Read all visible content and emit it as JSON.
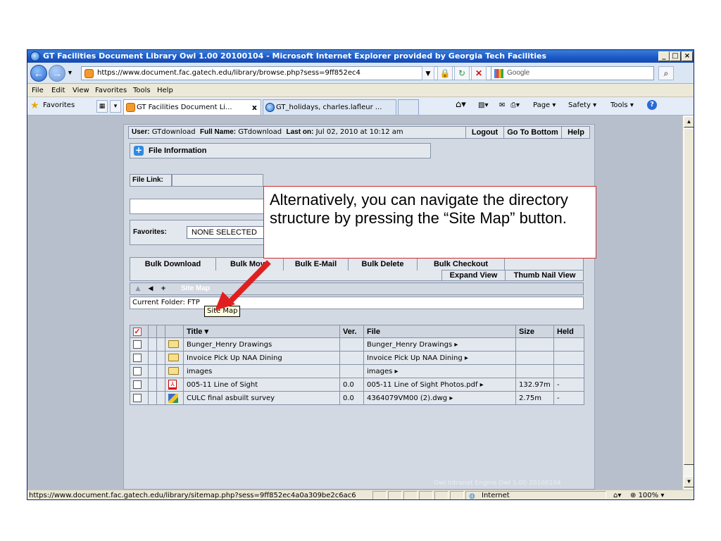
{
  "browser": {
    "title": "GT Facilities Document Library Owl 1.00 20100104 - Microsoft Internet Explorer provided by Georgia Tech Facilities",
    "address": "https://www.document.fac.gatech.edu/library/browse.php?sess=9ff852ec4",
    "search_placeholder": "Google",
    "menu": [
      "File",
      "Edit",
      "View",
      "Favorites",
      "Tools",
      "Help"
    ],
    "favorites_label": "Favorites",
    "tabs": [
      {
        "label": "GT Facilities Document Li...",
        "close": "x",
        "active": true
      },
      {
        "label": "GT_holidays, charles.lafleur ...",
        "active": false
      }
    ],
    "commands": [
      "Page",
      "Safety",
      "Tools"
    ],
    "status_url": "https://www.document.fac.gatech.edu/library/sitemap.php?sess=9ff852ec4a0a309be2c6ac6",
    "zone": "Internet",
    "zoom": "100%"
  },
  "app": {
    "user_label": "User:",
    "user": "GTdownload",
    "fullname_label": "Full Name:",
    "fullname": "GTdownload",
    "laston_label": "Last on:",
    "laston": "Jul 02, 2010 at 10:12 am",
    "buttons": {
      "logout": "Logout",
      "go_bottom": "Go To Bottom",
      "help": "Help"
    },
    "file_information": "File Information",
    "file_link": "File Link:",
    "favorites_label": "Favorites:",
    "favorites_value": "NONE SELECTED",
    "bulk": [
      "Bulk Download",
      "Bulk Move",
      "Bulk E-Mail",
      "Bulk Delete",
      "Bulk Checkout"
    ],
    "expand_view": "Expand View",
    "thumb_view": "Thumb Nail View",
    "site_map": "Site Map",
    "current_folder": "Current Folder: FTP",
    "tooltip": "Site Map",
    "table": {
      "headers": {
        "title": "Title",
        "ver": "Ver.",
        "file": "File",
        "size": "Size",
        "held": "Held"
      },
      "rows": [
        {
          "icon": "folder",
          "title": "Bunger_Henry Drawings",
          "ver": "",
          "file": "Bunger_Henry Drawings",
          "size": "",
          "held": ""
        },
        {
          "icon": "folder",
          "title": "Invoice Pick Up NAA Dining",
          "ver": "",
          "file": "Invoice Pick Up NAA Dining",
          "size": "",
          "held": ""
        },
        {
          "icon": "folder",
          "title": "images",
          "ver": "",
          "file": "images",
          "size": "",
          "held": ""
        },
        {
          "icon": "pdf",
          "title": "005-11 Line of Sight",
          "ver": "0.0",
          "file": "005-11 Line of Sight Photos.pdf",
          "size": "132.97m",
          "held": "-"
        },
        {
          "icon": "dwg",
          "title": "CULC final asbuilt survey",
          "ver": "0.0",
          "file": "4364079VM00 (2).dwg",
          "size": "2.75m",
          "held": "-"
        }
      ]
    },
    "footer": "Owl Intranet Engine Owl 1.00 20100104"
  },
  "callout": {
    "text": "Alternatively, you can navigate the directory structure by pressing the “Site Map” button.",
    "border_color": "#d22c2c",
    "arrow_color": "#e02020"
  }
}
